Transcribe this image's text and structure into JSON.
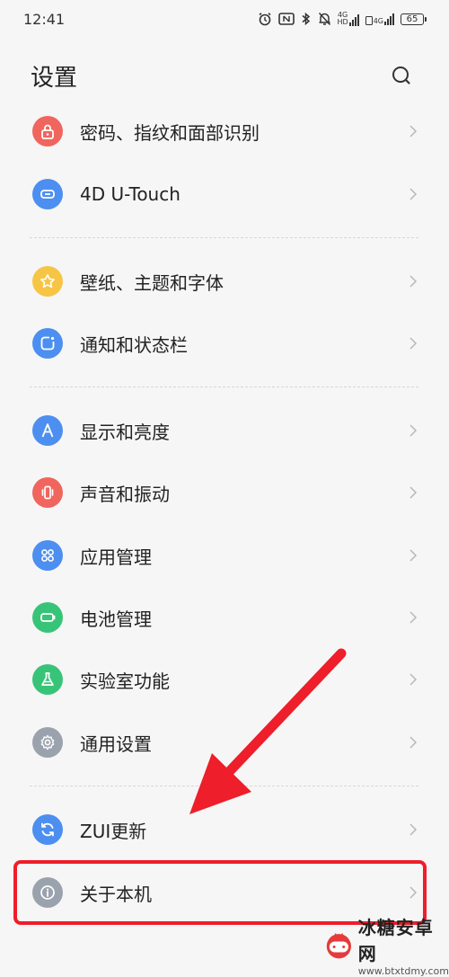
{
  "status": {
    "time": "12:41",
    "net1": "4G",
    "net1_sub": "HD",
    "net2": "4G",
    "battery": "65"
  },
  "header": {
    "title": "设置"
  },
  "settings": {
    "items": [
      {
        "label": "密码、指纹和面部识别",
        "color": "#f0655d",
        "icon": "lock-icon"
      },
      {
        "label": "4D U-Touch",
        "color": "#4d8ff0",
        "icon": "touch-icon"
      },
      {
        "label": "壁纸、主题和字体",
        "color": "#f7c545",
        "icon": "star-icon"
      },
      {
        "label": "通知和状态栏",
        "color": "#4d8ff0",
        "icon": "notification-icon"
      },
      {
        "label": "显示和亮度",
        "color": "#4d8ff0",
        "icon": "display-icon"
      },
      {
        "label": "声音和振动",
        "color": "#f0655d",
        "icon": "vibration-icon"
      },
      {
        "label": "应用管理",
        "color": "#4d8ff0",
        "icon": "apps-icon"
      },
      {
        "label": "电池管理",
        "color": "#38c478",
        "icon": "battery-icon"
      },
      {
        "label": "实验室功能",
        "color": "#38c478",
        "icon": "flask-icon"
      },
      {
        "label": "通用设置",
        "color": "#9aa3ad",
        "icon": "gear-icon"
      },
      {
        "label": "ZUI更新",
        "color": "#4d8ff0",
        "icon": "update-icon"
      },
      {
        "label": "关于本机",
        "color": "#9aa3ad",
        "icon": "info-icon"
      }
    ]
  },
  "annotation": {
    "highlight_color": "#ee1e2a"
  },
  "watermark": {
    "name": "冰糖安卓网",
    "url": "www.btxtdmy.com"
  }
}
